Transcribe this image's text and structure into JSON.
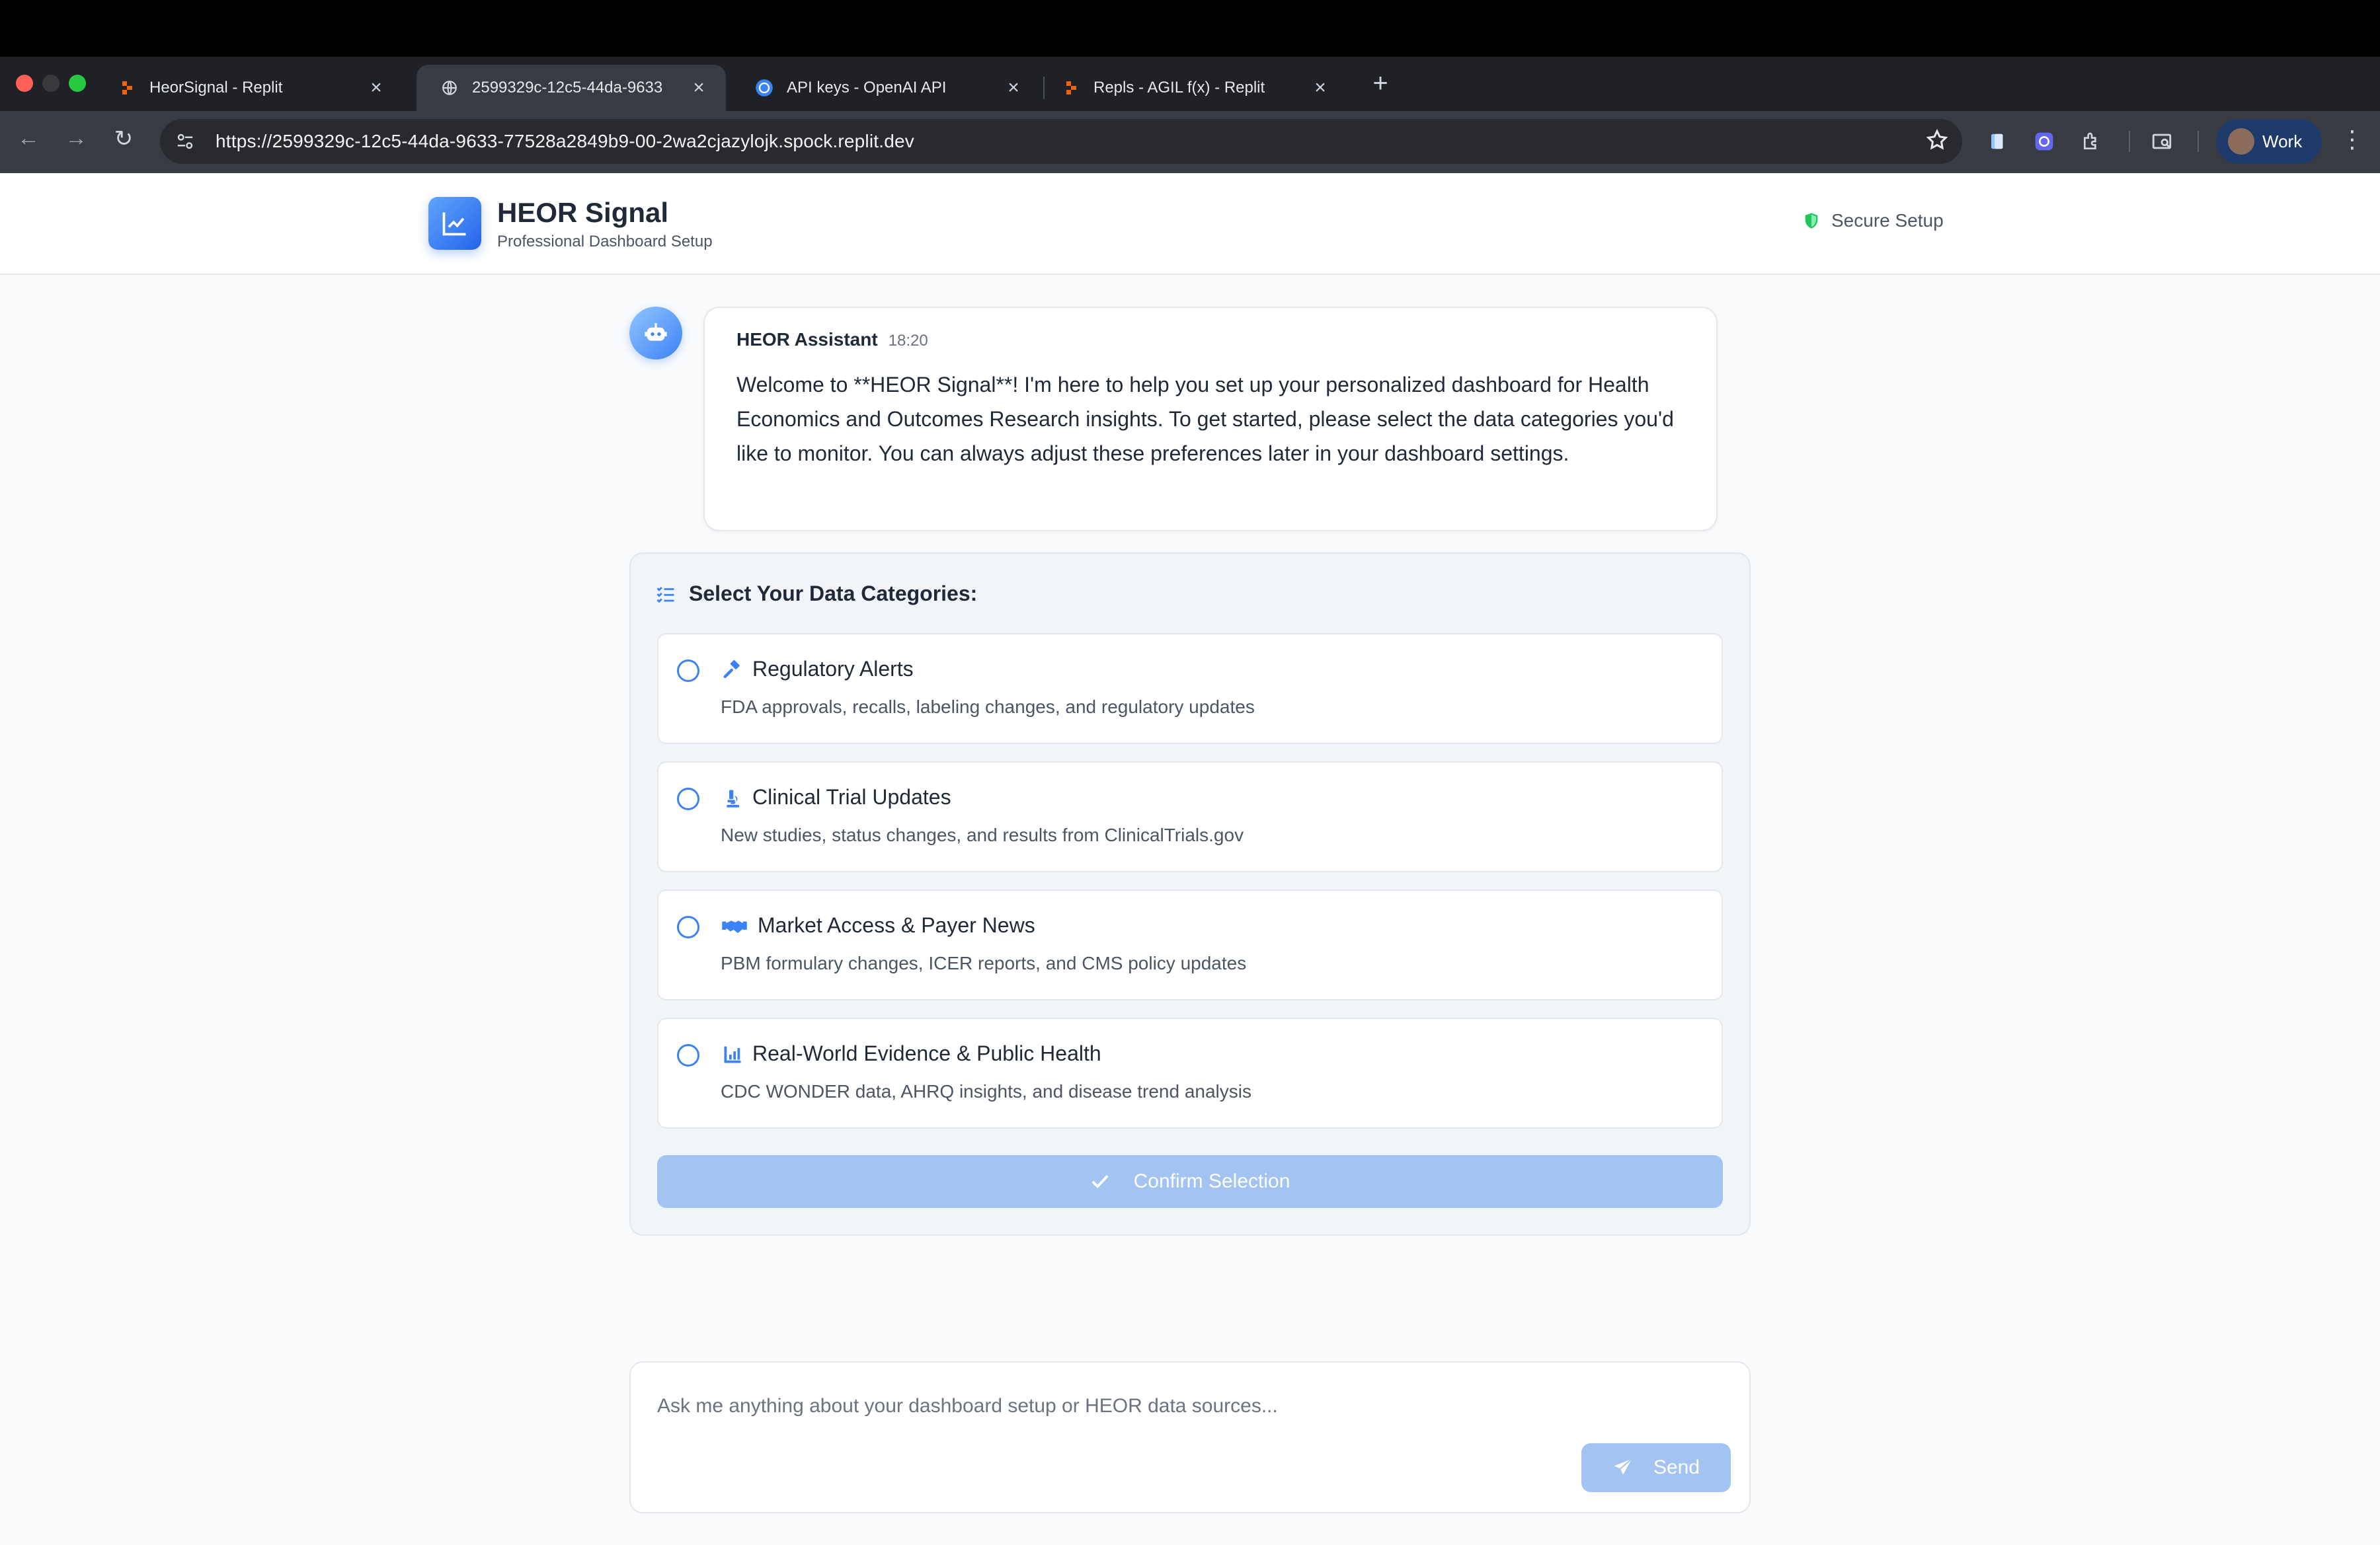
{
  "browser": {
    "tabs": [
      {
        "title": "HeorSignal - Replit",
        "icon": "replit-icon",
        "active": false
      },
      {
        "title": "2599329c-12c5-44da-9633",
        "icon": "globe-icon",
        "active": true
      },
      {
        "title": "API keys - OpenAI API",
        "icon": "openai-icon",
        "active": false
      },
      {
        "title": "Repls - AGIL f(x) - Replit",
        "icon": "replit-icon",
        "active": false
      }
    ],
    "url": "https://2599329c-12c5-44da-9633-77528a2849b9-00-2wa2cjazylojk.spock.replit.dev",
    "profile_label": "Work"
  },
  "header": {
    "title": "HEOR Signal",
    "subtitle": "Professional Dashboard Setup",
    "secure_label": "Secure Setup"
  },
  "message": {
    "author": "HEOR Assistant",
    "time": "18:20",
    "text": "Welcome to **HEOR Signal**! I'm here to help you set up your personalized dashboard for Health Economics and Outcomes Research insights. To get started, please select the data categories you'd like to monitor. You can always adjust these preferences later in your dashboard settings."
  },
  "categories": {
    "heading": "Select Your Data Categories:",
    "options": [
      {
        "title": "Regulatory Alerts",
        "desc": "FDA approvals, recalls, labeling changes, and regulatory updates",
        "icon": "gavel-icon",
        "selected": false
      },
      {
        "title": "Clinical Trial Updates",
        "desc": "New studies, status changes, and results from ClinicalTrials.gov",
        "icon": "microscope-icon",
        "selected": false
      },
      {
        "title": "Market Access & Payer News",
        "desc": "PBM formulary changes, ICER reports, and CMS policy updates",
        "icon": "handshake-icon",
        "selected": false
      },
      {
        "title": "Real-World Evidence & Public Health",
        "desc": "CDC WONDER data, AHRQ insights, and disease trend analysis",
        "icon": "chart-icon",
        "selected": false
      }
    ],
    "confirm_label": "Confirm Selection"
  },
  "chat": {
    "placeholder": "Ask me anything about your dashboard setup or HEOR data sources...",
    "value": "",
    "send_label": "Send"
  },
  "colors": {
    "accent": "#3b82f6",
    "button_disabled": "#a3c4f3",
    "secure_green": "#22c55e"
  }
}
